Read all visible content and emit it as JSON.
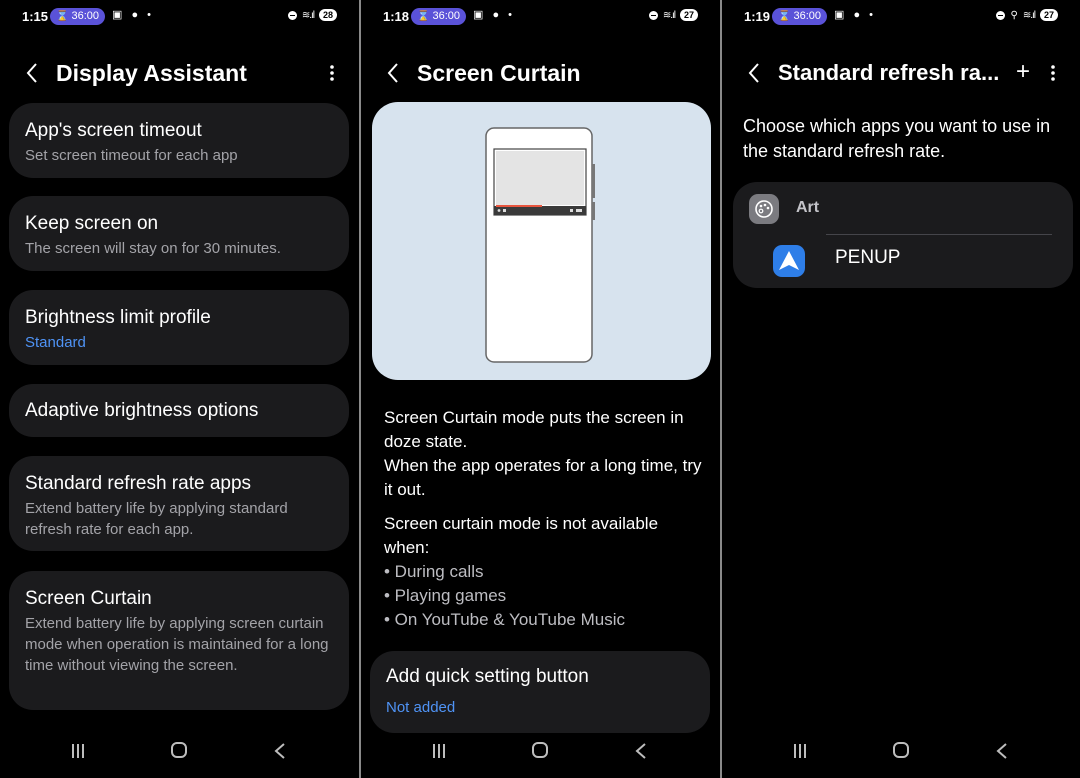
{
  "panels": [
    {
      "status": {
        "time": "1:15",
        "timer": "36:00",
        "battery": "28"
      },
      "title": "Display Assistant",
      "cards": [
        {
          "title": "App's screen timeout",
          "subtitle": "Set screen timeout for each app"
        },
        {
          "title": "Keep screen on",
          "subtitle": "The screen will stay on for 30 minutes."
        },
        {
          "title": "Brightness limit profile",
          "subtitle": "Standard"
        },
        {
          "title": "Adaptive brightness options",
          "subtitle": ""
        },
        {
          "title": "Standard refresh rate apps",
          "subtitle": "Extend battery life by applying standard refresh rate for each app."
        },
        {
          "title": "Screen Curtain",
          "subtitle": "Extend battery life by applying screen curtain mode when operation is maintained for a long time without viewing the screen."
        }
      ]
    },
    {
      "status": {
        "time": "1:18",
        "timer": "36:00",
        "battery": "27"
      },
      "title": "Screen Curtain",
      "description": [
        "Screen Curtain mode puts the screen in doze state.",
        "When the app operates for a long time, try it out."
      ],
      "unavailable_heading": "Screen curtain mode is not available when:",
      "bullets": [
        "• During calls",
        "• Playing games",
        "• On YouTube & YouTube Music"
      ],
      "quick_setting": {
        "title": "Add quick setting button",
        "status": "Not added"
      }
    },
    {
      "status": {
        "time": "1:19",
        "timer": "36:00",
        "battery": "27"
      },
      "title": "Standard refresh ra...",
      "description": "Choose which apps you want to use in the standard refresh rate.",
      "category": "Art",
      "apps": [
        "PENUP"
      ]
    }
  ],
  "colors": {
    "accent_blue": "#4f93f5",
    "timer_pill": "#5a52d8",
    "card_bg": "#1b1b1d",
    "illustration_bg": "#d7e3ee"
  },
  "icons": [
    "back-icon",
    "more-options-icon",
    "add-icon",
    "palette-icon",
    "penup-icon",
    "recents-icon",
    "home-icon",
    "nav-back-icon"
  ]
}
